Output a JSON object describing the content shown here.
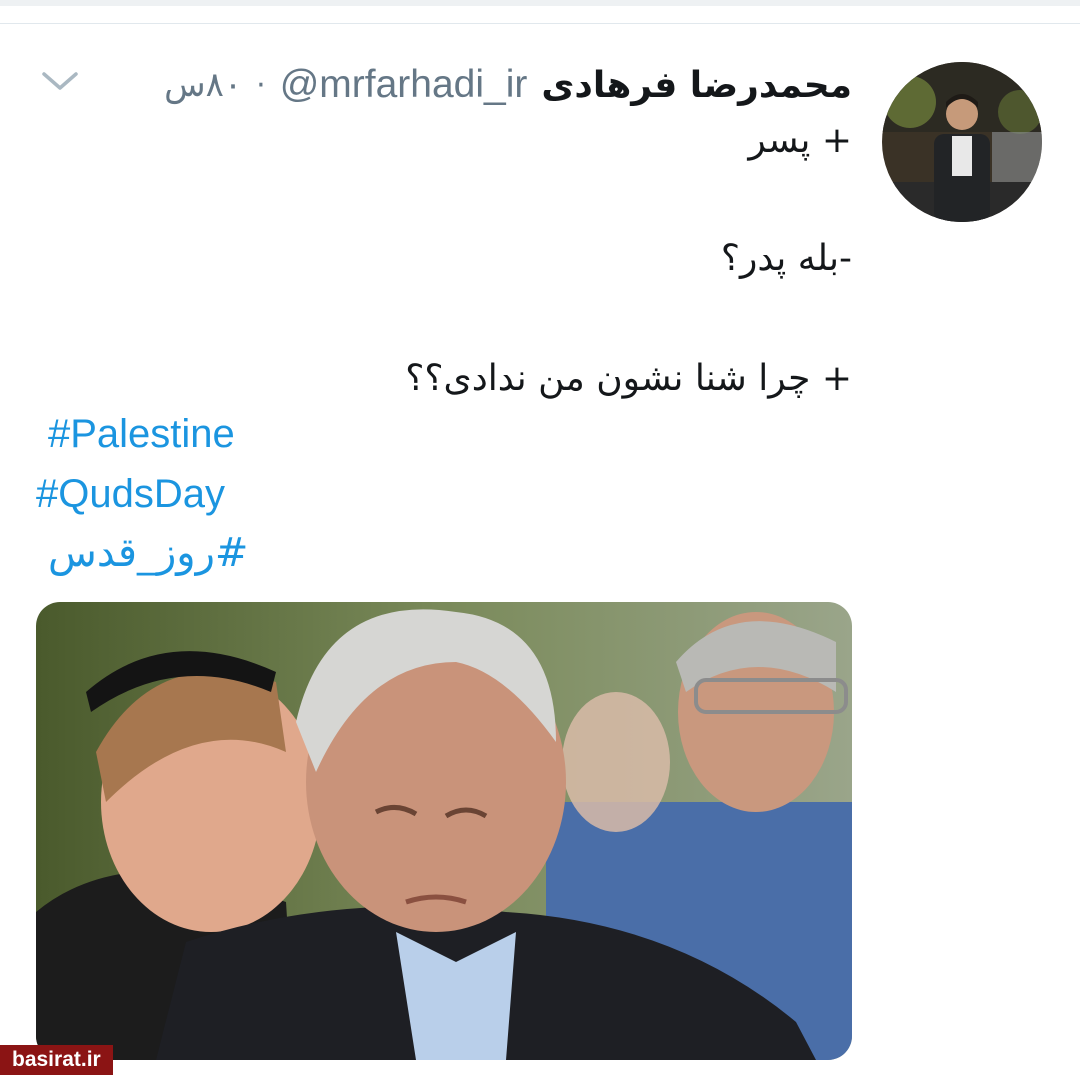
{
  "tweet": {
    "display_name": "محمدرضا فرهادی",
    "handle": "@mrfarhadi_ir",
    "separator": "·",
    "timestamp": "۸۰س",
    "lines": [
      "+ پسر",
      "-بله پدر؟",
      "+ چرا شنا نشون من ندادی؟؟"
    ],
    "hashtags": [
      "#Palestine",
      "#QudsDay",
      "#روز_قدس"
    ],
    "menu_icon": "chevron-down-icon"
  },
  "watermark": "basirat.ir",
  "colors": {
    "name": "#14171a",
    "secondary": "#657786",
    "hashtag": "#1b95e0",
    "watermark_bg": "#8b1414"
  }
}
